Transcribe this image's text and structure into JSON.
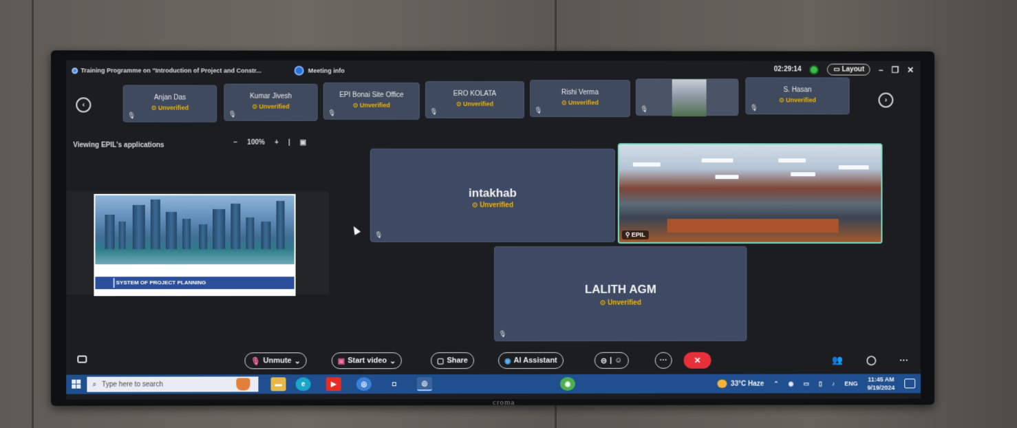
{
  "window": {
    "title": "Training Programme on \"Introduction of Project and Constr...",
    "meeting_info": "Meeting info",
    "timer": "02:29:14",
    "layout_label": "Layout",
    "minimize": "–",
    "restore": "❐",
    "close": "✕"
  },
  "participants_strip": [
    {
      "name": "Anjan Das",
      "status": "Unverified"
    },
    {
      "name": "Kumar Jivesh",
      "status": "Unverified"
    },
    {
      "name": "EPI Bonai Site Office",
      "status": "Unverified"
    },
    {
      "name": "ERO KOLATA",
      "status": "Unverified"
    },
    {
      "name": "Rishi Verma",
      "status": "Unverified"
    },
    {
      "name": "",
      "status": ""
    },
    {
      "name": "S. Hasan",
      "status": "Unverified"
    }
  ],
  "viewing": {
    "label": "Viewing EPIL's applications",
    "zoom": "100%",
    "zoom_out": "−",
    "zoom_in": "+"
  },
  "slide": {
    "heading": "SYSTEM OF PROJECT PLANNING"
  },
  "tiles": {
    "intakhab": {
      "name": "intakhab",
      "status": "Unverified"
    },
    "lalith": {
      "name": "LALITH AGM",
      "status": "Unverified"
    },
    "video_label": "EPIL"
  },
  "controls": {
    "unmute": "Unmute",
    "start_video": "Start video",
    "share": "Share",
    "ai_assistant": "AI Assistant",
    "more": "···",
    "end": "✕"
  },
  "taskbar": {
    "search_placeholder": "Type here to search",
    "weather": "33°C Haze",
    "language": "ENG",
    "time": "11:45 AM",
    "date": "9/19/2024"
  },
  "tv_brand": "croma",
  "colors": {
    "unverified": "#f0b400",
    "tile_bg": "#3e4a63",
    "end_call": "#e8303a",
    "taskbar": "#1f4f8e"
  }
}
